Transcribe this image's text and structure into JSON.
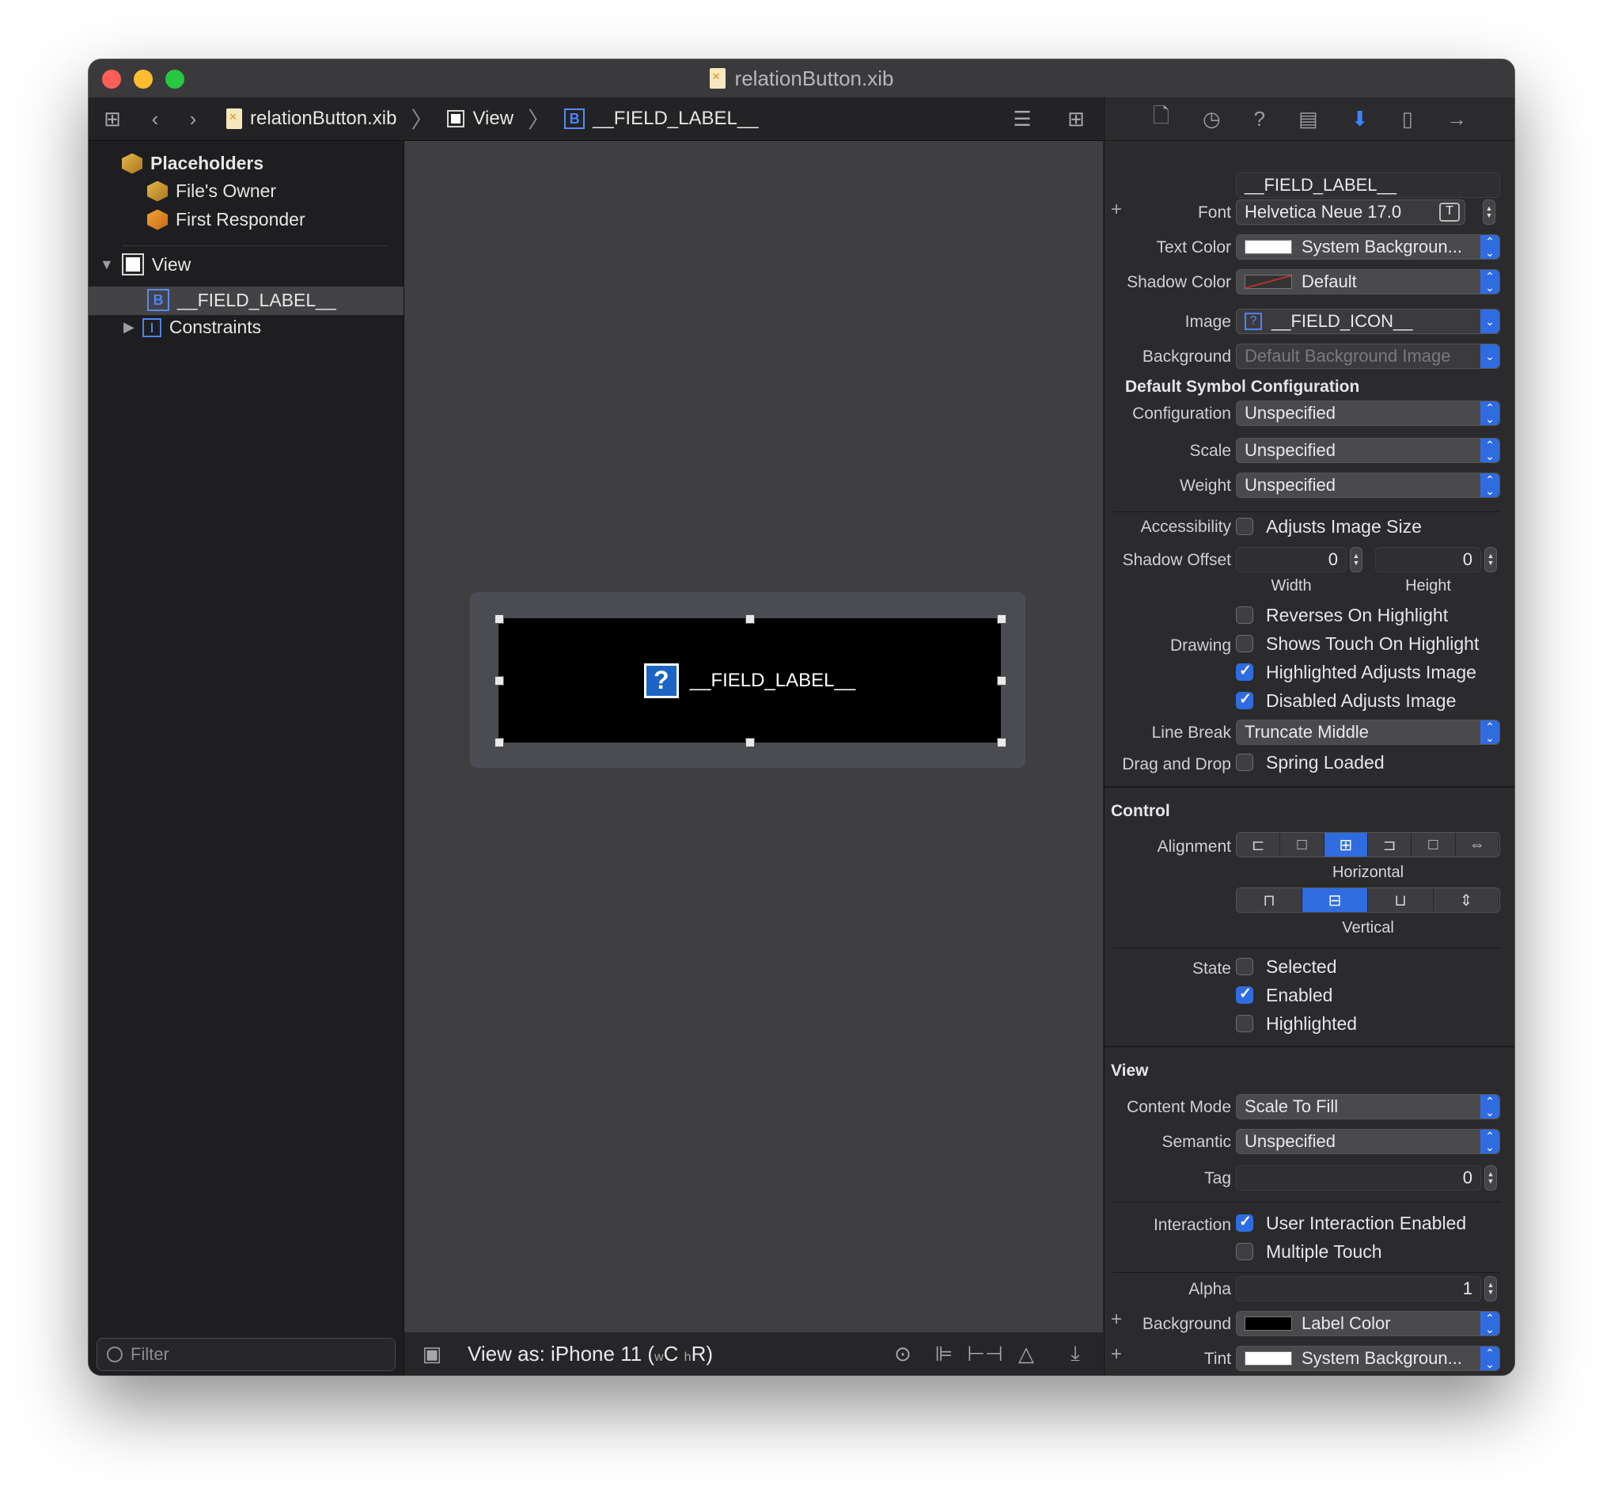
{
  "window": {
    "title": "relationButton.xib",
    "traffic_colors": {
      "close": "#ff5f57",
      "minimize": "#febc2e",
      "zoom": "#28c840"
    }
  },
  "navbar": {
    "breadcrumbs": [
      "relationButton.xib",
      "View",
      "__FIELD_LABEL__"
    ],
    "b_badge": "B"
  },
  "outline": {
    "placeholders": "Placeholders",
    "files_owner": "File's Owner",
    "first_responder": "First Responder",
    "view": "View",
    "field_label": "__FIELD_LABEL__",
    "constraints": "Constraints",
    "filter_placeholder": "Filter"
  },
  "canvas": {
    "button_label": "__FIELD_LABEL__",
    "view_as": "View as: iPhone 11 (",
    "size_w": "w",
    "size_c": "C",
    "size_h": "h",
    "size_r": "R",
    "close_paren": ")"
  },
  "inspector": {
    "header_value": "__FIELD_LABEL__",
    "font_label": "Font",
    "font_value": "Helvetica Neue 17.0",
    "text_color_label": "Text Color",
    "text_color_value": "System Backgroun...",
    "shadow_color_label": "Shadow Color",
    "shadow_color_value": "Default",
    "image_label": "Image",
    "image_value": "__FIELD_ICON__",
    "background_label": "Background",
    "background_placeholder": "Default Background Image",
    "symbol_section": "Default Symbol Configuration",
    "configuration_label": "Configuration",
    "configuration_value": "Unspecified",
    "scale_label": "Scale",
    "scale_value": "Unspecified",
    "weight_label": "Weight",
    "weight_value": "Unspecified",
    "accessibility_label": "Accessibility",
    "adjusts_image_size": "Adjusts Image Size",
    "shadow_offset_label": "Shadow Offset",
    "shadow_width": "0",
    "shadow_height": "0",
    "width_caption": "Width",
    "height_caption": "Height",
    "reverses_on_highlight": "Reverses On Highlight",
    "drawing_label": "Drawing",
    "shows_touch": "Shows Touch On Highlight",
    "highlighted_adjusts": "Highlighted Adjusts Image",
    "disabled_adjusts": "Disabled Adjusts Image",
    "line_break_label": "Line Break",
    "line_break_value": "Truncate Middle",
    "drag_drop_label": "Drag and Drop",
    "spring_loaded": "Spring Loaded",
    "control_section": "Control",
    "alignment_label": "Alignment",
    "horizontal_caption": "Horizontal",
    "vertical_caption": "Vertical",
    "state_label": "State",
    "selected": "Selected",
    "enabled": "Enabled",
    "highlighted": "Highlighted",
    "view_section": "View",
    "content_mode_label": "Content Mode",
    "content_mode_value": "Scale To Fill",
    "semantic_label": "Semantic",
    "semantic_value": "Unspecified",
    "tag_label": "Tag",
    "tag_value": "0",
    "interaction_label": "Interaction",
    "user_interaction": "User Interaction Enabled",
    "multiple_touch": "Multiple Touch",
    "alpha_label": "Alpha",
    "alpha_value": "1",
    "background2_label": "Background",
    "background2_value": "Label Color",
    "tint_label": "Tint",
    "tint_value": "System Backgroun...",
    "plus": "+"
  },
  "state": {
    "adjusts_image_size": false,
    "reverses_on_highlight": false,
    "shows_touch": false,
    "highlighted_adjusts": true,
    "disabled_adjusts": true,
    "spring_loaded": false,
    "selected": false,
    "enabled": true,
    "highlighted": false,
    "user_interaction": true,
    "multiple_touch": false
  },
  "colors": {
    "accent": "#2f6ce0",
    "canvas": "#3f3f41",
    "sidebar": "#1e1e20"
  }
}
